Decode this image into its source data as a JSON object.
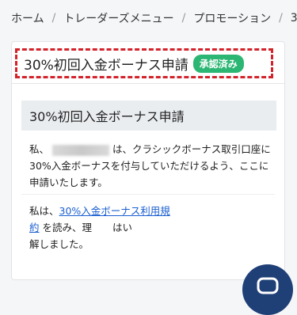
{
  "breadcrumb": {
    "items": [
      "ホーム",
      "トレーダーズメニュー",
      "プロモーション",
      "3"
    ],
    "separator": "/"
  },
  "card": {
    "title": "30%初回入金ボーナス申請",
    "status_badge": "承認済み",
    "section_title": "30%初回入金ボーナス申請",
    "paragraph1": {
      "prefix": "私、",
      "suffix": "は、クラシックボーナス取引口座に30%入金ボーナスを付与していただけるよう、ここに申請いたします。"
    },
    "paragraph2": {
      "prefix": "私は、",
      "link": "30%入金ボーナス利用規約",
      "middle": "を読み、理",
      "agree": "はい",
      "suffix": "解しました。"
    }
  },
  "colors": {
    "badge": "#2bb673",
    "highlight_border": "#d3222a",
    "link": "#1a5fd1",
    "fab": "#1f3f77"
  },
  "icons": {
    "chat": "chat-icon"
  }
}
